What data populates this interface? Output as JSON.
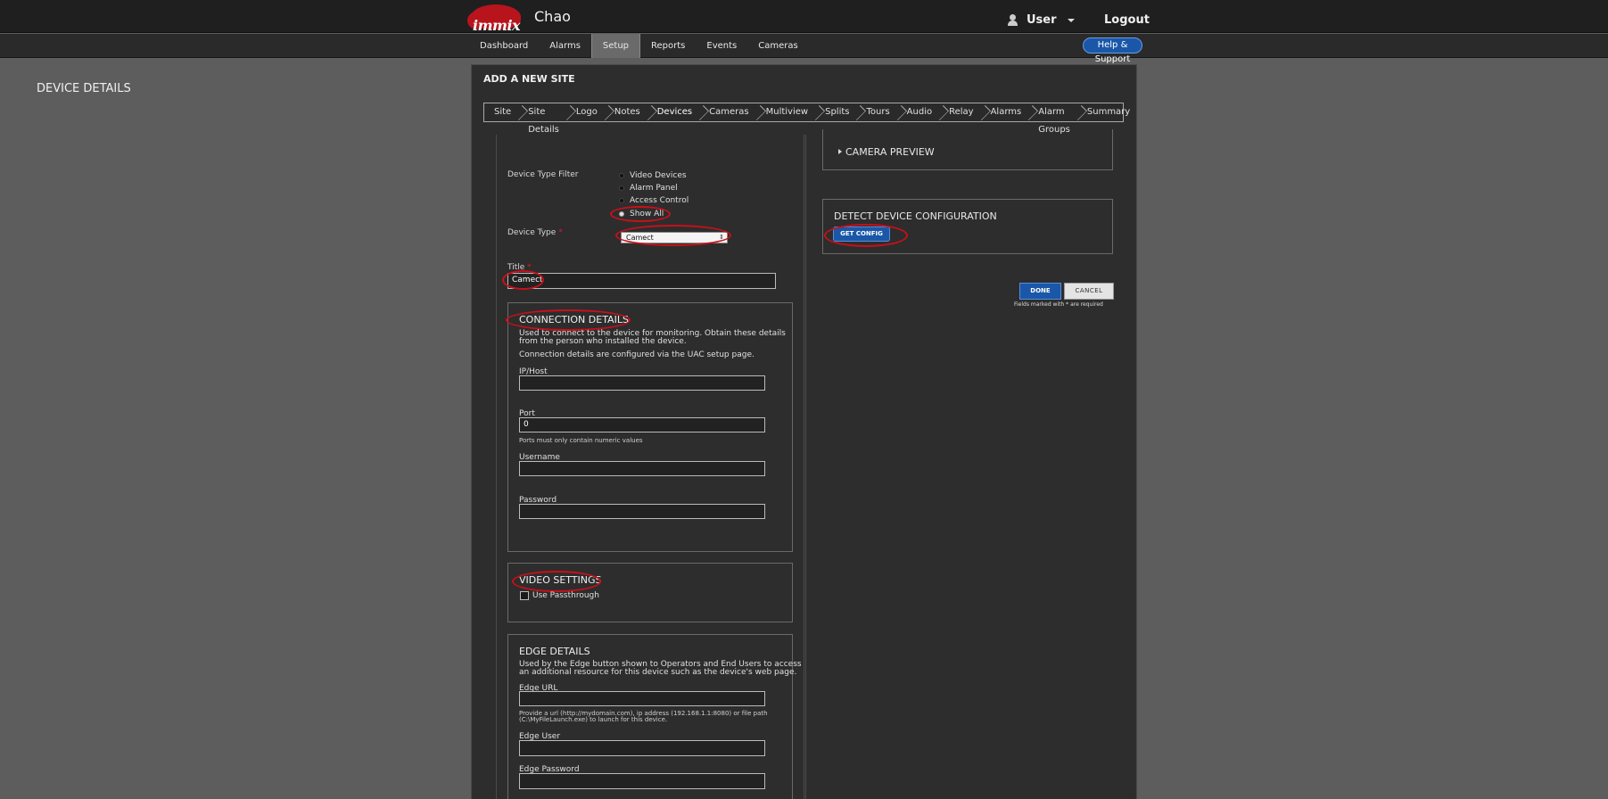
{
  "header": {
    "logo_text": "immix",
    "company": "Chao",
    "user_label": "User",
    "logout_label": "Logout"
  },
  "nav": {
    "items": [
      "Dashboard",
      "Alarms",
      "Setup",
      "Reports",
      "Events",
      "Cameras"
    ],
    "active": "Setup",
    "help_label": "Help & Support"
  },
  "panel": {
    "title": "ADD A NEW SITE",
    "steps": [
      "Site",
      "Site Details",
      "Logo",
      "Notes",
      "Devices",
      "Cameras",
      "Multiview",
      "Splits",
      "Tours",
      "Audio",
      "Relay",
      "Alarms",
      "Alarm Groups",
      "Summary"
    ],
    "active_step": "Devices"
  },
  "device_details": {
    "title": "DEVICE DETAILS",
    "filter_label": "Device Type Filter",
    "filter_options": [
      "Video Devices",
      "Alarm Panel",
      "Access Control",
      "Show All"
    ],
    "filter_selected": "Show All",
    "device_type_label": "Device Type",
    "required_mark": "*",
    "device_type_value": "Camect",
    "title_label": "Title",
    "title_value": "Camect"
  },
  "connection": {
    "title": "CONNECTION DETAILS",
    "desc_line1": "Used to connect to the device for monitoring. Obtain these details",
    "desc_line2": "from the person who installed the device.",
    "note": "Connection details are configured via the UAC setup page.",
    "ip_label": "IP/Host",
    "ip_value": "",
    "port_label": "Port",
    "port_value": "0",
    "port_hint": "Ports must only contain numeric values",
    "username_label": "Username",
    "username_value": "",
    "password_label": "Password",
    "password_value": ""
  },
  "video": {
    "title": "VIDEO SETTINGS",
    "passthrough_label": "Use Passthrough"
  },
  "edge": {
    "title": "EDGE DETAILS",
    "desc_line1": "Used by the Edge button shown to Operators and End Users to access",
    "desc_line2": "an additional resource for this device such as the device's web page.",
    "url_label": "Edge URL",
    "url_hint_line1": "Provide a url (http://mydomain.com), ip address (192.168.1.1:8080) or file path",
    "url_hint_line2": "(C:\\MyFileLaunch.exe) to launch for this device.",
    "user_label": "Edge User",
    "password_label": "Edge Password"
  },
  "right": {
    "preview_title": "CAMERA PREVIEW",
    "detect_title": "DETECT DEVICE CONFIGURATION",
    "get_config_label": "GET CONFIG",
    "done_label": "DONE",
    "cancel_label": "CANCEL",
    "required_note": "Fields marked with * are required"
  },
  "colors": {
    "accent_blue": "#1a57a8",
    "annotation_red": "#c8101a",
    "background": "#5d5d5d",
    "panel": "#2d2d2d"
  }
}
